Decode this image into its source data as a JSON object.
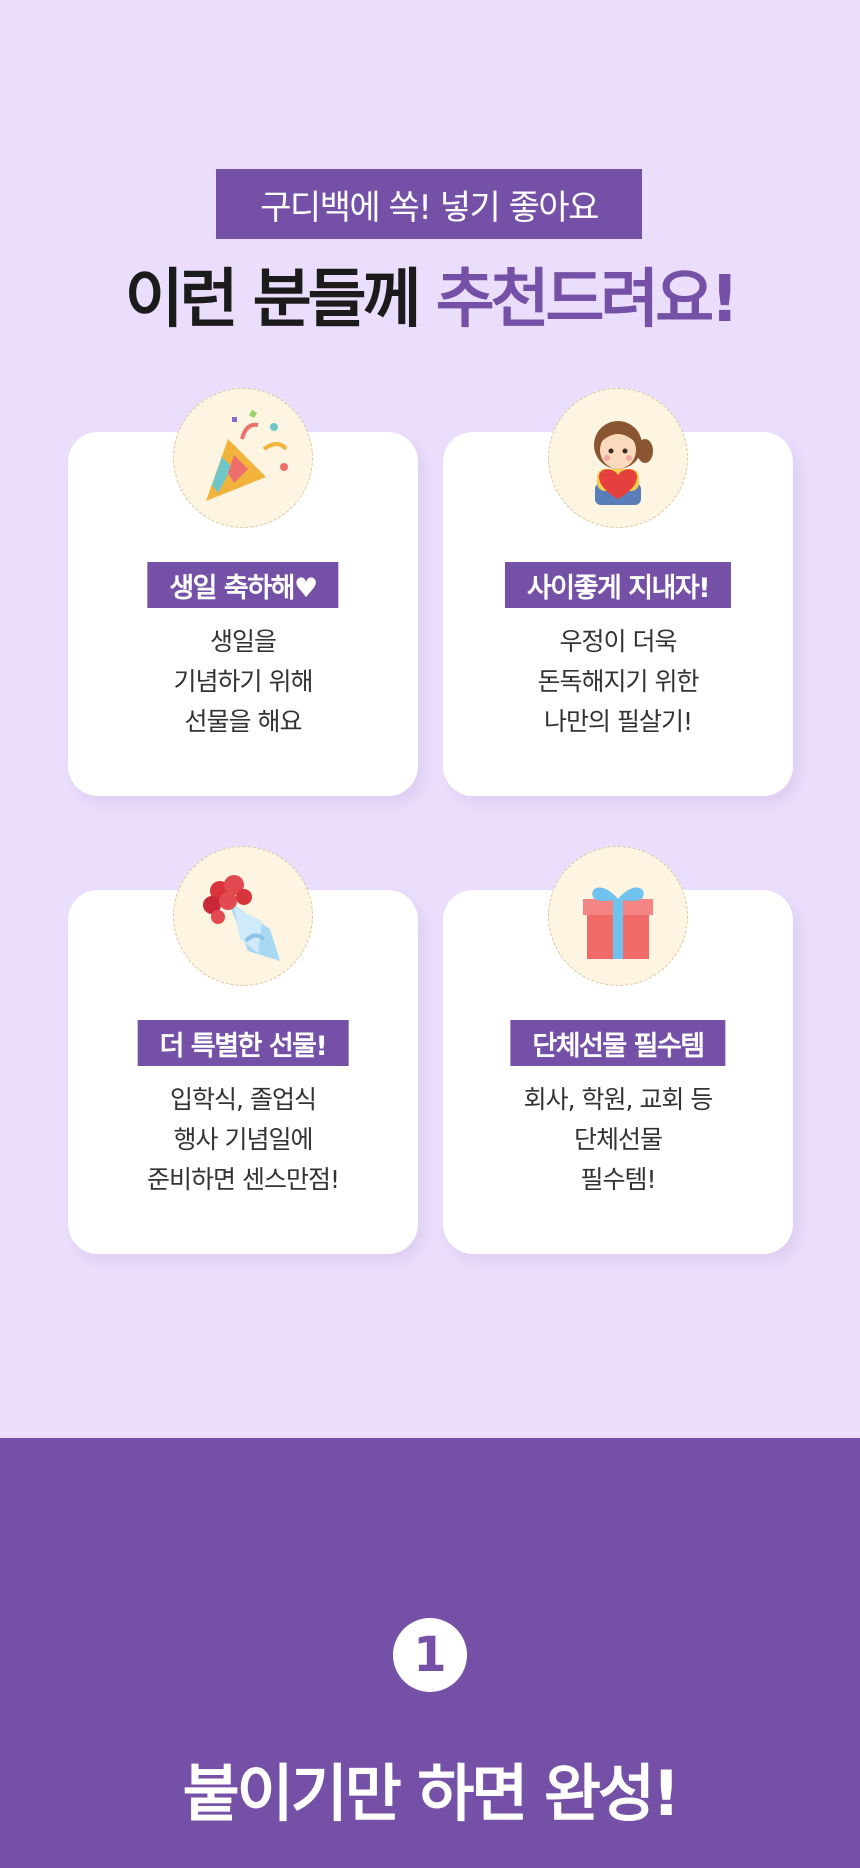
{
  "header": {
    "sub_label": "구디백에 쏙! 넣기 좋아요",
    "title_dark": "이런 분들께 ",
    "title_accent": "추천드려요!"
  },
  "cards": [
    {
      "icon": "party-popper-icon",
      "tag": "생일 축하해♥",
      "lines": [
        "생일을",
        "기념하기 위해",
        "선물을 해요"
      ]
    },
    {
      "icon": "girl-with-heart-icon",
      "tag": "사이좋게 지내자!",
      "lines": [
        "우정이 더욱",
        "돈독해지기 위한",
        "나만의 필살기!"
      ]
    },
    {
      "icon": "flower-bouquet-icon",
      "tag": "더 특별한 선물!",
      "lines": [
        "입학식, 졸업식",
        "행사 기념일에",
        "준비하면 센스만점!"
      ]
    },
    {
      "icon": "gift-box-icon",
      "tag": "단체선물 필수템",
      "lines": [
        "회사, 학원, 교회 등",
        "단체선물",
        "필수템!"
      ]
    }
  ],
  "section": {
    "step_number": "1",
    "title": "붙이기만 하면 완성!"
  },
  "colors": {
    "background": "#ebddfc",
    "accent": "#7451a7",
    "card": "#ffffff",
    "icon_circle": "#fdf4e1"
  }
}
